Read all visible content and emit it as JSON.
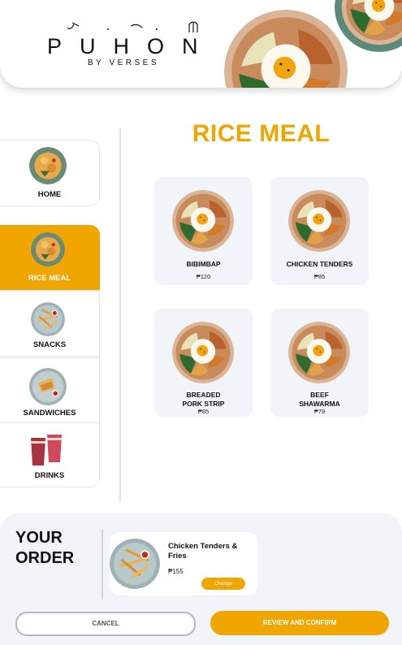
{
  "brand": {
    "name": "PUHON",
    "subtitle": "BY VERSES"
  },
  "colors": {
    "accent": "#f0a500",
    "card_bg": "#f1f4f9",
    "panel_bg": "#f1f4f9"
  },
  "sidebar": {
    "items": [
      {
        "label": "HOME",
        "icon": "home-food-icon",
        "active": false
      },
      {
        "label": "RICE MEAL",
        "icon": "rice-meal-icon",
        "active": true
      },
      {
        "label": "SNACKS",
        "icon": "snacks-icon",
        "active": false
      },
      {
        "label": "SANDWICHES",
        "icon": "sandwiches-icon",
        "active": false
      },
      {
        "label": "DRINKS",
        "icon": "drinks-icon",
        "active": false
      }
    ]
  },
  "main": {
    "title": "RICE MEAL",
    "products": [
      {
        "name": "BIBIMBAP",
        "price": "₱120"
      },
      {
        "name": "CHICKEN TENDERS",
        "price": "₱85"
      },
      {
        "name": "BREADED\nPORK STRIP",
        "price": "₱85"
      },
      {
        "name": "BEEF\nSHAWARMA",
        "price": "₱79"
      }
    ]
  },
  "order": {
    "title": "YOUR\nORDER",
    "item": {
      "name": "Chicken Tenders & Fries",
      "price": "₱155",
      "change_label": "Change"
    }
  },
  "actions": {
    "cancel": "CANCEL",
    "confirm": "REVIEW AND CONFIRM"
  }
}
